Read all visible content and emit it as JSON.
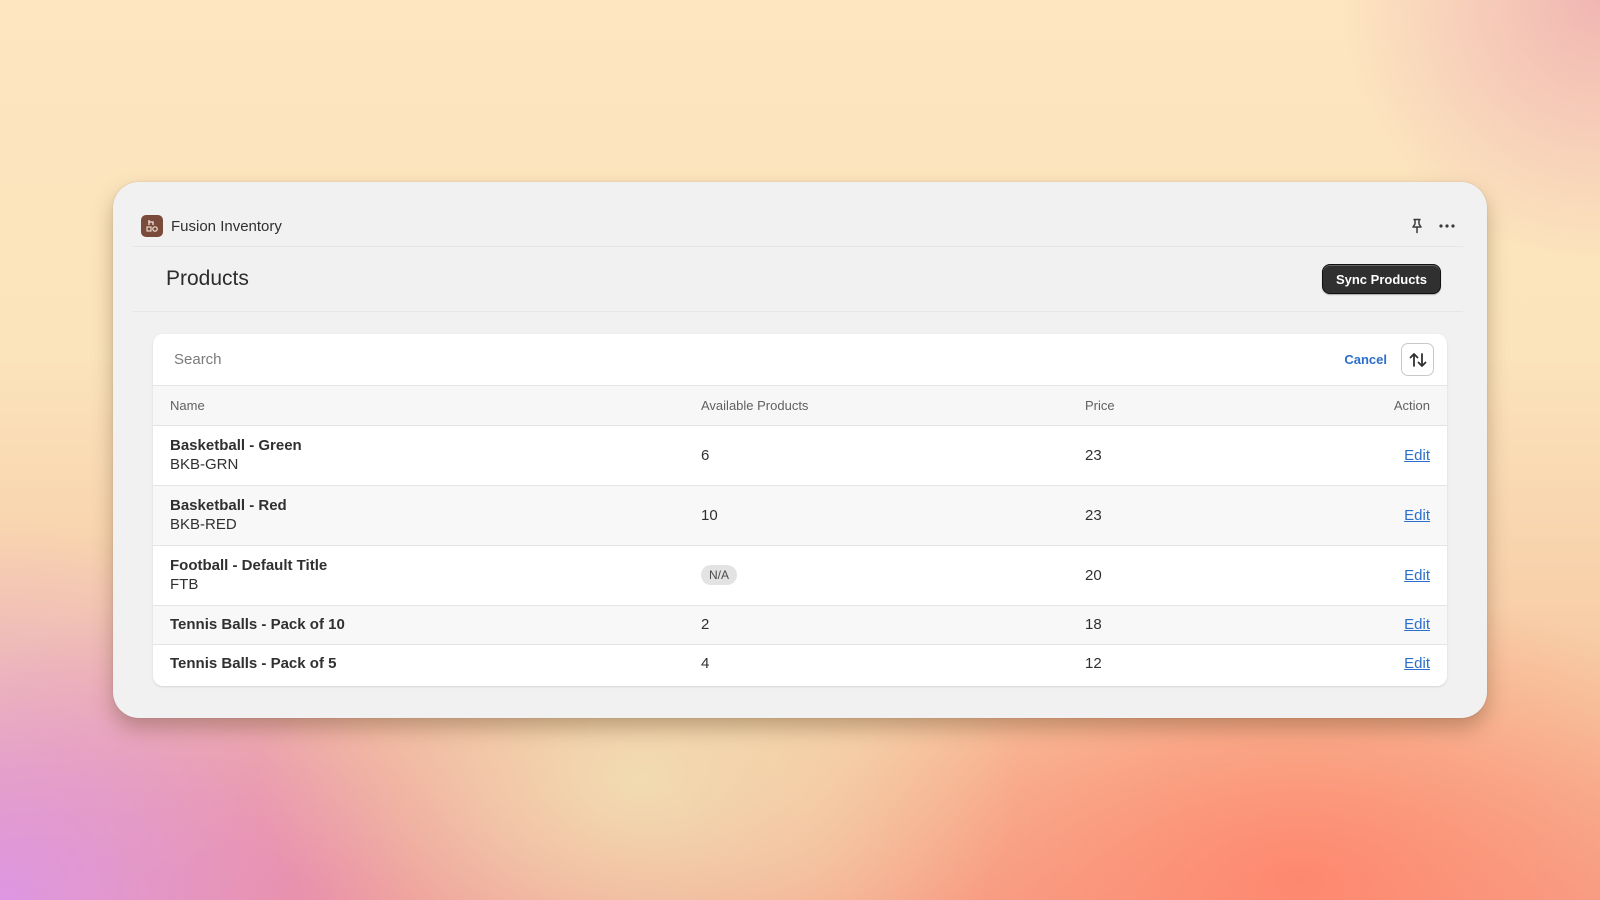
{
  "app": {
    "title": "Fusion Inventory",
    "icon": "fusion-inventory-logo",
    "accent_color": "#7a4b3a"
  },
  "titlebar": {
    "pin_icon": "pin-icon",
    "more_icon": "ellipsis-icon"
  },
  "page": {
    "title": "Products",
    "primary_action_label": "Sync Products"
  },
  "search": {
    "placeholder": "Search",
    "value": "",
    "cancel_label": "Cancel",
    "sort_icon": "sort-arrows-icon"
  },
  "table": {
    "columns": [
      "Name",
      "Available Products",
      "Price",
      "Action"
    ],
    "rows": [
      {
        "name": "Basketball - Green",
        "sku": "BKB-GRN",
        "available": "6",
        "price": "23",
        "action": "Edit"
      },
      {
        "name": "Basketball - Red",
        "sku": "BKB-RED",
        "available": "10",
        "price": "23",
        "action": "Edit"
      },
      {
        "name": "Football - Default Title",
        "sku": "FTB",
        "available": "N/A",
        "available_is_badge": true,
        "price": "20",
        "action": "Edit"
      },
      {
        "name": "Tennis Balls - Pack of 10",
        "sku": "",
        "available": "2",
        "price": "18",
        "action": "Edit"
      },
      {
        "name": "Tennis Balls - Pack of 5",
        "sku": "",
        "available": "4",
        "price": "12",
        "action": "Edit"
      }
    ]
  },
  "colors": {
    "link": "#2c6ecb",
    "primary_button": "#303030",
    "badge_bg": "#e3e3e3"
  }
}
